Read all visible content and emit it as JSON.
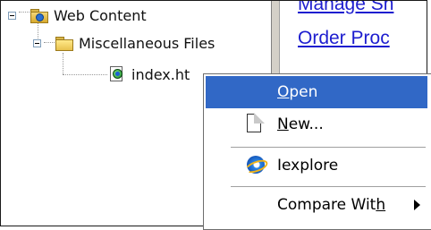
{
  "tree": {
    "items": [
      {
        "label": "Web Content",
        "icon": "web-folder-icon"
      },
      {
        "label": "Miscellaneous Files",
        "icon": "folder-icon"
      },
      {
        "label": "index.ht",
        "icon": "html-file-icon"
      }
    ]
  },
  "links": [
    {
      "text": "Manage Sh"
    },
    {
      "text": "Order Proc"
    }
  ],
  "context_menu": {
    "items": [
      {
        "label": "Open",
        "mnemonic": "O",
        "rest": "pen",
        "selected": true
      },
      {
        "label": "New...",
        "mnemonic": "N",
        "rest": "ew...",
        "icon": "new-document-icon"
      },
      {
        "label": "Iexplore",
        "icon": "internet-explorer-icon"
      },
      {
        "label": "Compare With",
        "pre": "Compare Wit",
        "mnemonic": "h",
        "icon_right": "submenu-arrow-icon"
      }
    ]
  },
  "colors": {
    "selection": "#3168c6",
    "link": "#1d1dcf",
    "splitter": "#d4d0c8"
  }
}
